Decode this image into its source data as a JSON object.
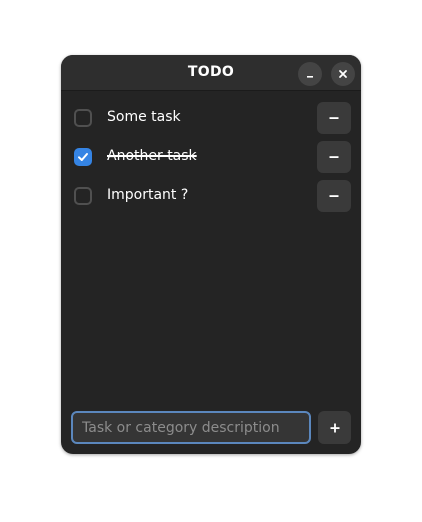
{
  "window": {
    "title": "TODO",
    "controls": [
      {
        "name": "minimize",
        "icon": "minimize-icon"
      },
      {
        "name": "close",
        "icon": "close-icon"
      }
    ]
  },
  "tasks": [
    {
      "label": "Some task",
      "done": false,
      "remove_icon": "minus-icon"
    },
    {
      "label": "Another task",
      "done": true,
      "remove_icon": "minus-icon"
    },
    {
      "label": "Important ?",
      "done": false,
      "remove_icon": "minus-icon"
    }
  ],
  "entry": {
    "value": "",
    "placeholder": "Task or category description"
  },
  "add_button": {
    "icon": "plus-icon"
  },
  "colors": {
    "window_bg": "#242424",
    "headerbar_bg": "#2e2e2e",
    "accent": "#3584e4",
    "button_bg": "#3a3a3a",
    "focus_border": "#5b87bd"
  }
}
